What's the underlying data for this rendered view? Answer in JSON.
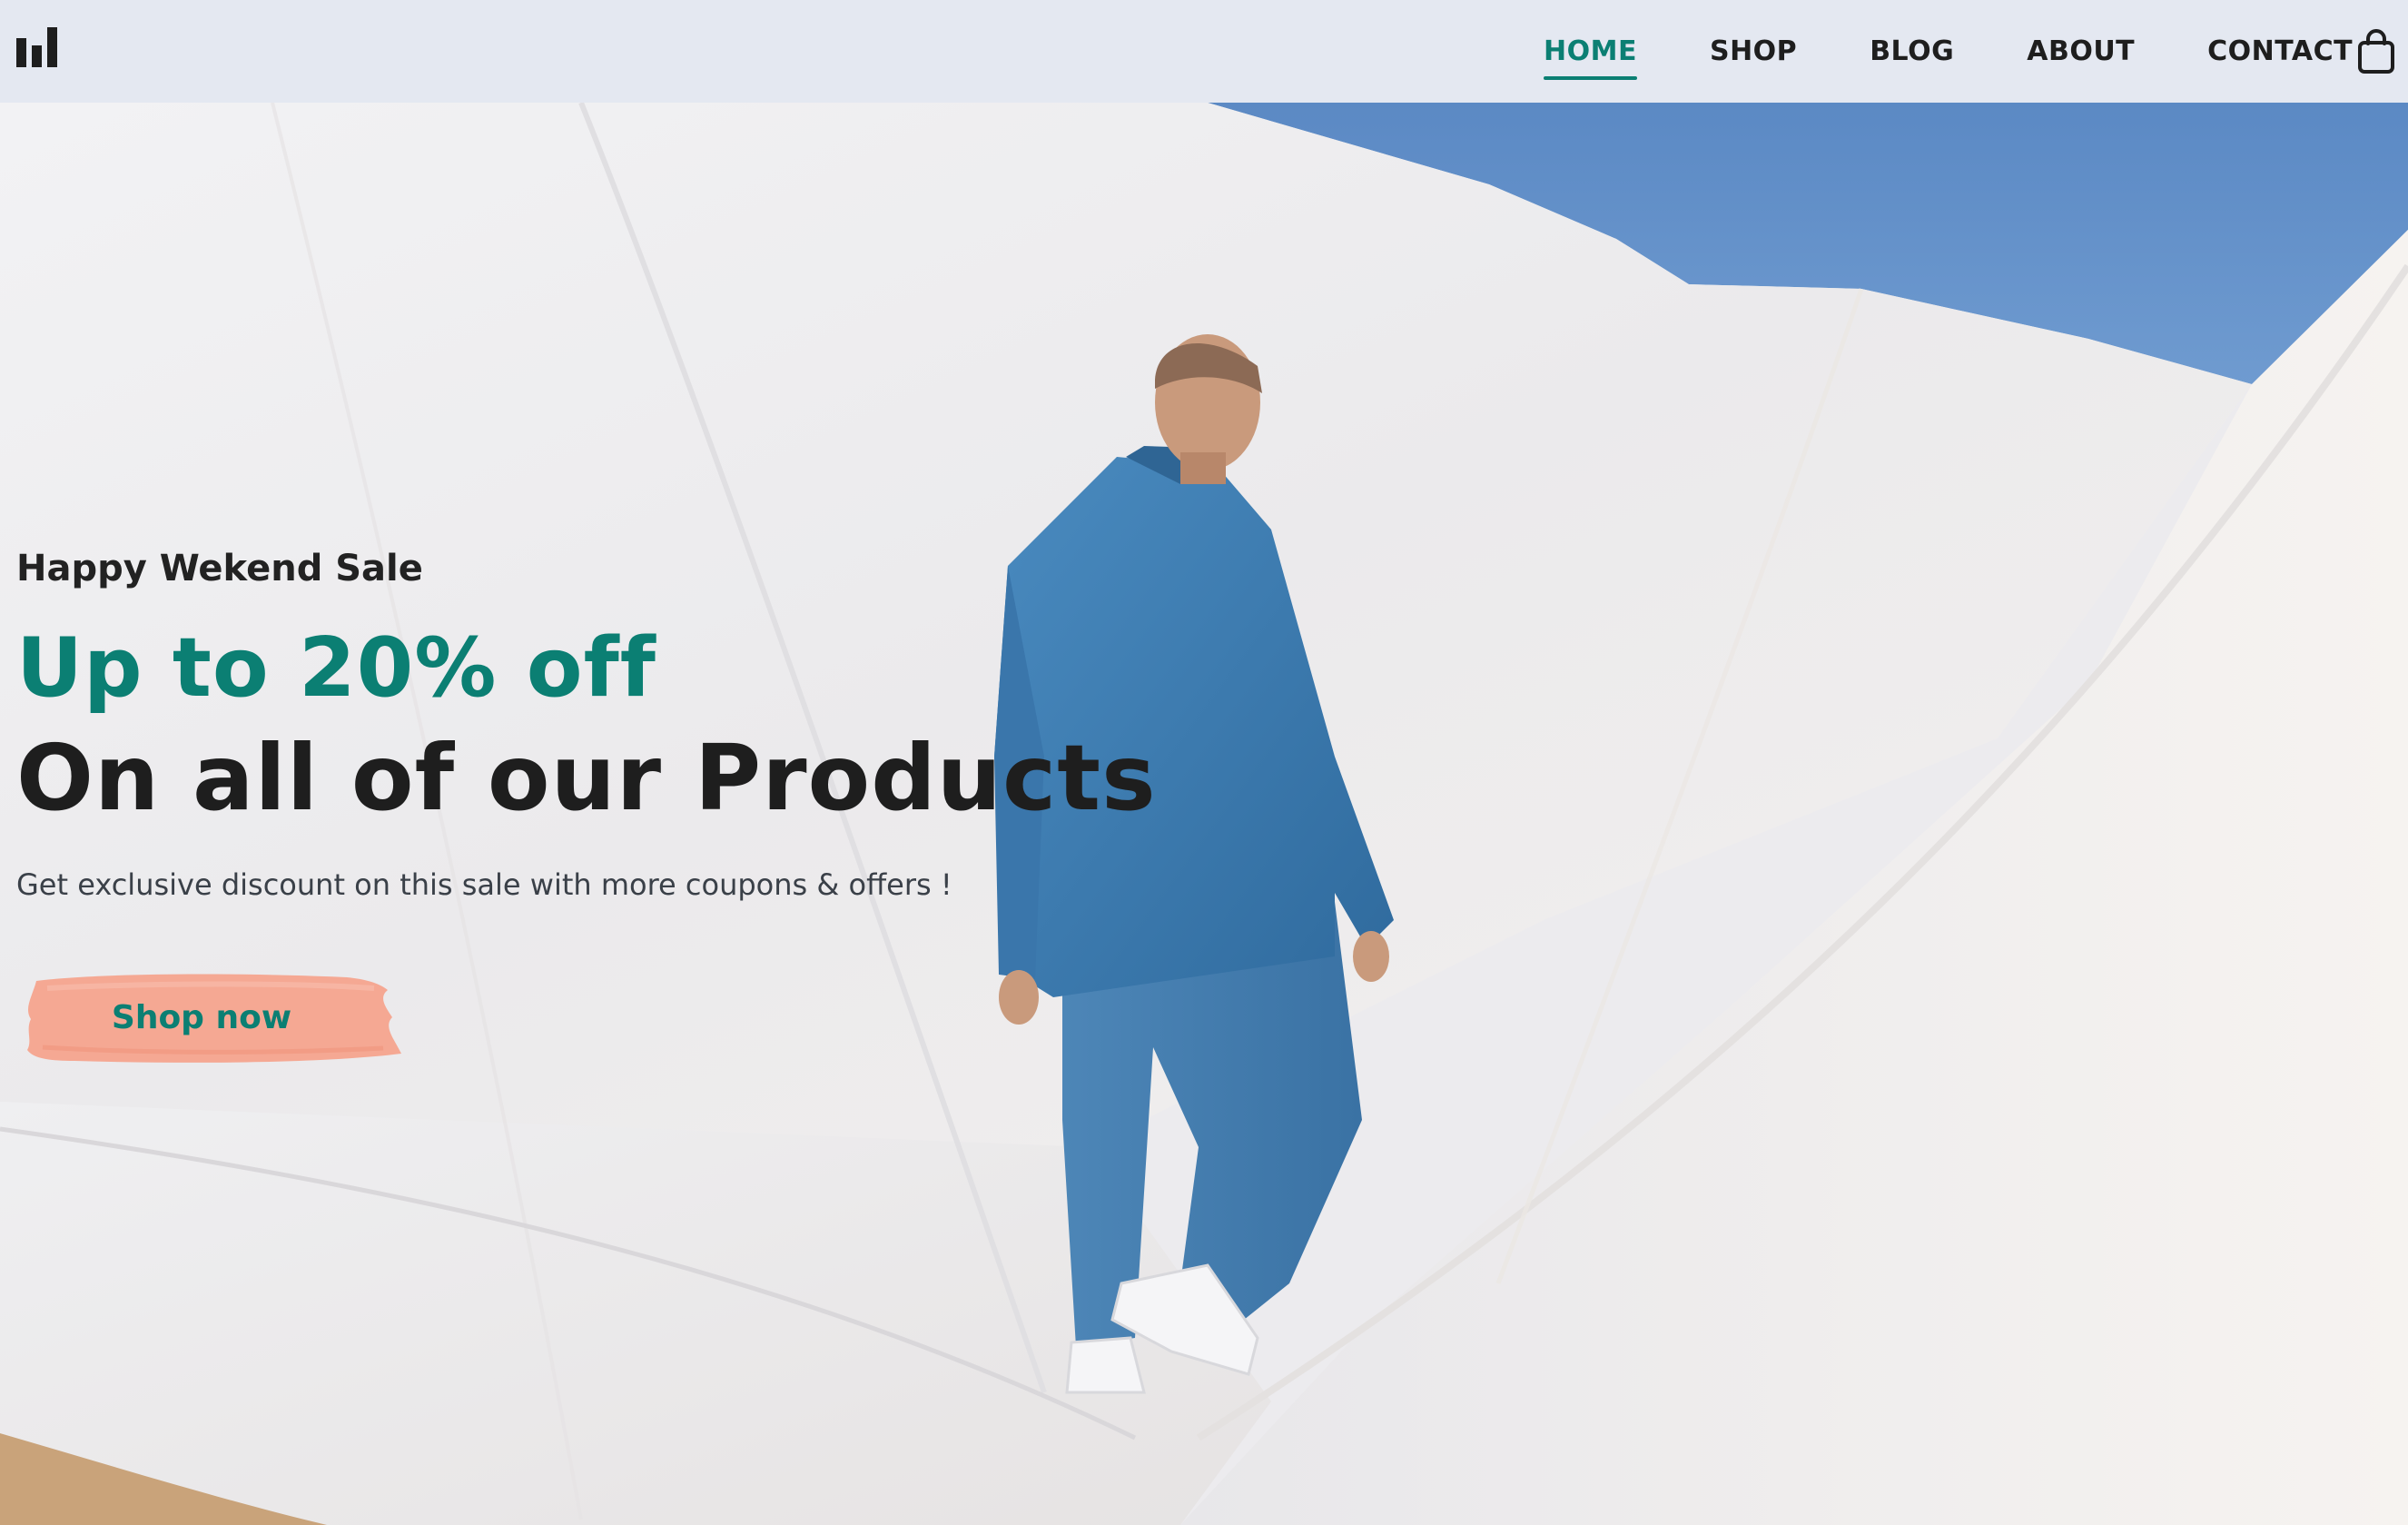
{
  "header": {
    "logo_icon": "bars-logo-icon",
    "nav": [
      {
        "label": "HOME",
        "active": true
      },
      {
        "label": "SHOP",
        "active": false
      },
      {
        "label": "BLOG",
        "active": false
      },
      {
        "label": "ABOUT",
        "active": false
      },
      {
        "label": "CONTACT",
        "active": false
      }
    ],
    "cart_icon": "shopping-bag-icon"
  },
  "hero": {
    "eyebrow": "Happy Wekend Sale",
    "headline_accent": "Up to 20% off",
    "headline_main": "On all of our Products",
    "subtext": "Get exclusive discount on this sale with more coupons & offers !",
    "cta_label": "Shop now",
    "image": "man-in-denim-walking-on-white-fabric-dunes"
  },
  "colors": {
    "accent": "#0b7f73",
    "heading": "#1e1e1e",
    "header_bg": "#e4e8f1",
    "cta_brush": "#f5a48e",
    "sky": "#5a8cc7",
    "denim": "#3f7fb5"
  }
}
